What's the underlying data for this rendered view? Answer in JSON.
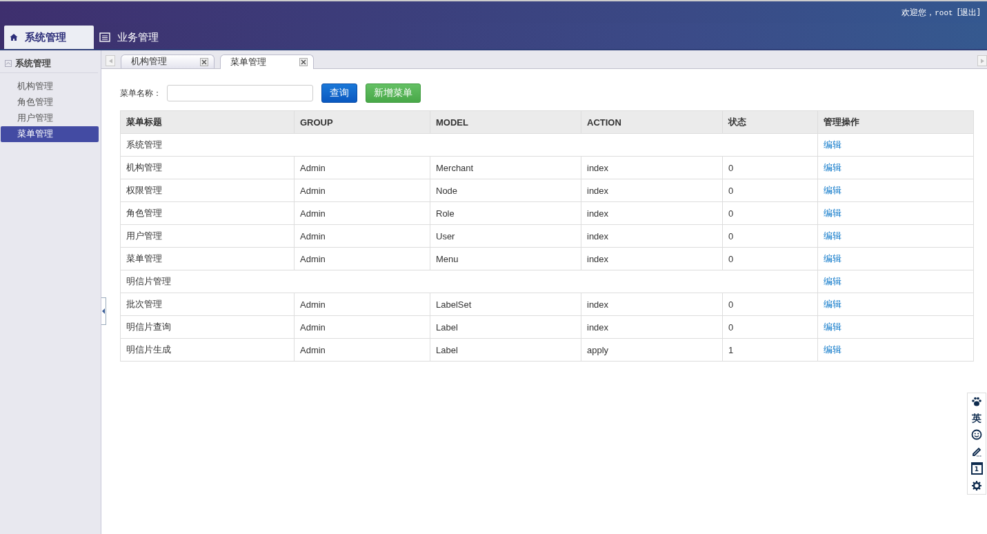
{
  "header": {
    "welcome": "欢迎您，",
    "user": "root",
    "logout": "[退出]"
  },
  "nav_tabs": [
    {
      "label": "系统管理",
      "selected": true
    },
    {
      "label": "业务管理",
      "selected": false
    }
  ],
  "sidebar": {
    "title": "系统管理",
    "expanded": true,
    "items": [
      {
        "label": "机构管理",
        "selected": false
      },
      {
        "label": "角色管理",
        "selected": false
      },
      {
        "label": "用户管理",
        "selected": false
      },
      {
        "label": "菜单管理",
        "selected": true
      }
    ]
  },
  "page_tabs": [
    {
      "label": "机构管理",
      "selected": false
    },
    {
      "label": "菜单管理",
      "selected": true
    }
  ],
  "search": {
    "label": "菜单名称：",
    "query_button": "查询",
    "add_button": "新增菜单"
  },
  "table": {
    "columns": [
      "菜单标题",
      "GROUP",
      "MODEL",
      "ACTION",
      "状态",
      "管理操作"
    ],
    "rows": [
      {
        "kind": "group",
        "title": "系统管理",
        "action_link": "编辑"
      },
      {
        "kind": "item",
        "title": "机构管理",
        "group": "Admin",
        "model": "Merchant",
        "action": "index",
        "status": "0",
        "action_link": "编辑"
      },
      {
        "kind": "item",
        "title": "权限管理",
        "group": "Admin",
        "model": "Node",
        "action": "index",
        "status": "0",
        "action_link": "编辑"
      },
      {
        "kind": "item",
        "title": "角色管理",
        "group": "Admin",
        "model": "Role",
        "action": "index",
        "status": "0",
        "action_link": "编辑"
      },
      {
        "kind": "item",
        "title": "用户管理",
        "group": "Admin",
        "model": "User",
        "action": "index",
        "status": "0",
        "action_link": "编辑"
      },
      {
        "kind": "item",
        "title": "菜单管理",
        "group": "Admin",
        "model": "Menu",
        "action": "index",
        "status": "0",
        "action_link": "编辑"
      },
      {
        "kind": "group",
        "title": "明信片管理",
        "action_link": "编辑"
      },
      {
        "kind": "item",
        "title": "批次管理",
        "group": "Admin",
        "model": "LabelSet",
        "action": "index",
        "status": "0",
        "action_link": "编辑"
      },
      {
        "kind": "item",
        "title": "明信片查询",
        "group": "Admin",
        "model": "Label",
        "action": "index",
        "status": "0",
        "action_link": "编辑"
      },
      {
        "kind": "item",
        "title": "明信片生成",
        "group": "Admin",
        "model": "Label",
        "action": "apply",
        "status": "1",
        "action_link": "编辑"
      }
    ]
  },
  "ime_toolbar": {
    "language": "英",
    "calendar_day": "1"
  }
}
